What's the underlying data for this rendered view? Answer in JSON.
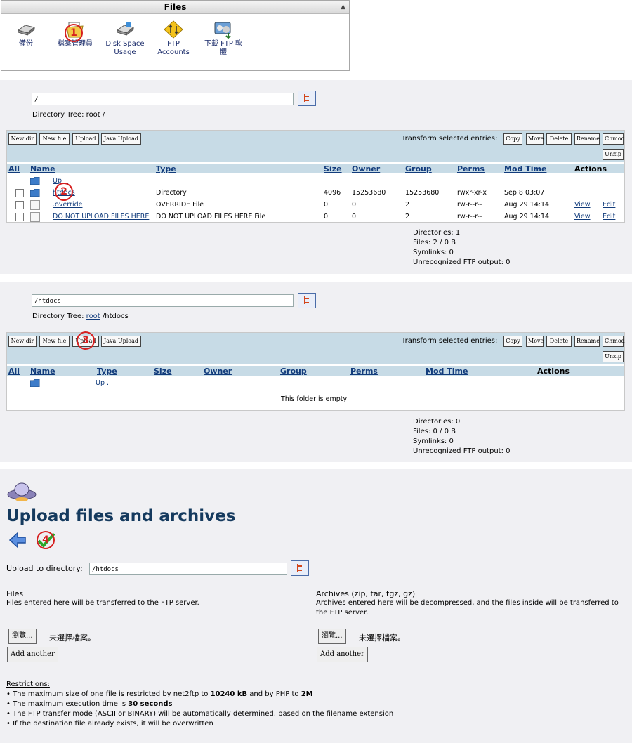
{
  "files_panel": {
    "title": "Files",
    "items": [
      {
        "label": "備份",
        "icon": "backup-icon"
      },
      {
        "label": "檔案管理員",
        "icon": "file-manager-icon"
      },
      {
        "label": "Disk Space Usage",
        "icon": "disk-usage-icon"
      },
      {
        "label": "FTP Accounts",
        "icon": "ftp-accounts-icon"
      },
      {
        "label": "下載 FTP 軟體",
        "icon": "ftp-software-icon"
      }
    ]
  },
  "markers": [
    "1",
    "2",
    "3",
    "4"
  ],
  "section1": {
    "path_value": "/",
    "tree_label": "Directory Tree:",
    "tree_root": "root",
    "tree_rest": "/",
    "buttons": [
      "New dir",
      "New file",
      "Upload",
      "Java Upload"
    ],
    "transform_label": "Transform selected entries:",
    "transform_buttons": [
      "Copy",
      "Move",
      "Delete",
      "Rename",
      "Chmod",
      "Unzip"
    ],
    "columns": [
      "All",
      "Name",
      "Type",
      "Size",
      "Owner",
      "Group",
      "Perms",
      "Mod Time",
      "Actions"
    ],
    "up_label": "Up ..",
    "rows": [
      {
        "name": "htdocs",
        "type": "Directory",
        "size": "4096",
        "owner": "15253680",
        "group": "15253680",
        "perms": "rwxr-xr-x",
        "mod": "Sep 8 03:07",
        "view": "",
        "edit": ""
      },
      {
        "name": ".override",
        "type": "OVERRIDE File",
        "size": "0",
        "owner": "0",
        "group": "2",
        "perms": "rw-r--r--",
        "mod": "Aug 29 14:14",
        "view": "View",
        "edit": "Edit"
      },
      {
        "name": "DO NOT UPLOAD FILES HERE",
        "type": "DO NOT UPLOAD FILES HERE File",
        "size": "0",
        "owner": "0",
        "group": "2",
        "perms": "rw-r--r--",
        "mod": "Aug 29 14:14",
        "view": "View",
        "edit": "Edit"
      }
    ],
    "stats": [
      "Directories: 1",
      "Files: 2 / 0 B",
      "Symlinks: 0",
      "Unrecognized FTP output: 0"
    ]
  },
  "section2": {
    "path_value": "/htdocs",
    "tree_label": "Directory Tree:",
    "tree_root": "root",
    "tree_rest": "/htdocs",
    "buttons": [
      "New dir",
      "New file",
      "Upload",
      "Java Upload"
    ],
    "transform_label": "Transform selected entries:",
    "transform_buttons": [
      "Copy",
      "Move",
      "Delete",
      "Rename",
      "Chmod",
      "Unzip"
    ],
    "columns": [
      "All",
      "Name",
      "Type",
      "Size",
      "Owner",
      "Group",
      "Perms",
      "Mod Time",
      "Actions"
    ],
    "up_label": "Up ..",
    "empty_text": "This folder is empty",
    "stats": [
      "Directories: 0",
      "Files: 0 / 0 B",
      "Symlinks: 0",
      "Unrecognized FTP output: 0"
    ]
  },
  "upload": {
    "title": "Upload files and archives",
    "dir_label": "Upload to directory:",
    "dir_value": "/htdocs",
    "files_heading": "Files",
    "files_desc": "Files entered here will be transferred to the FTP server.",
    "archives_heading": "Archives (zip, tar, tgz, gz)",
    "archives_desc": "Archives entered here will be decompressed, and the files inside will be transferred to the FTP server.",
    "browse_label": "瀏覽...",
    "no_file_label": "未選擇檔案。",
    "add_another": "Add another",
    "restrictions_heading": "Restrictions:",
    "r1_pre": "The maximum size of one file is restricted by net2ftp to ",
    "r1_b1": "10240 kB",
    "r1_mid": " and by PHP to ",
    "r1_b2": "2M",
    "r2_pre": "The maximum execution time is ",
    "r2_b": "30 seconds",
    "r3": "The FTP transfer mode (ASCII or BINARY) will be automatically determined, based on the filename extension",
    "r4": "If the destination file already exists, it will be overwritten"
  }
}
